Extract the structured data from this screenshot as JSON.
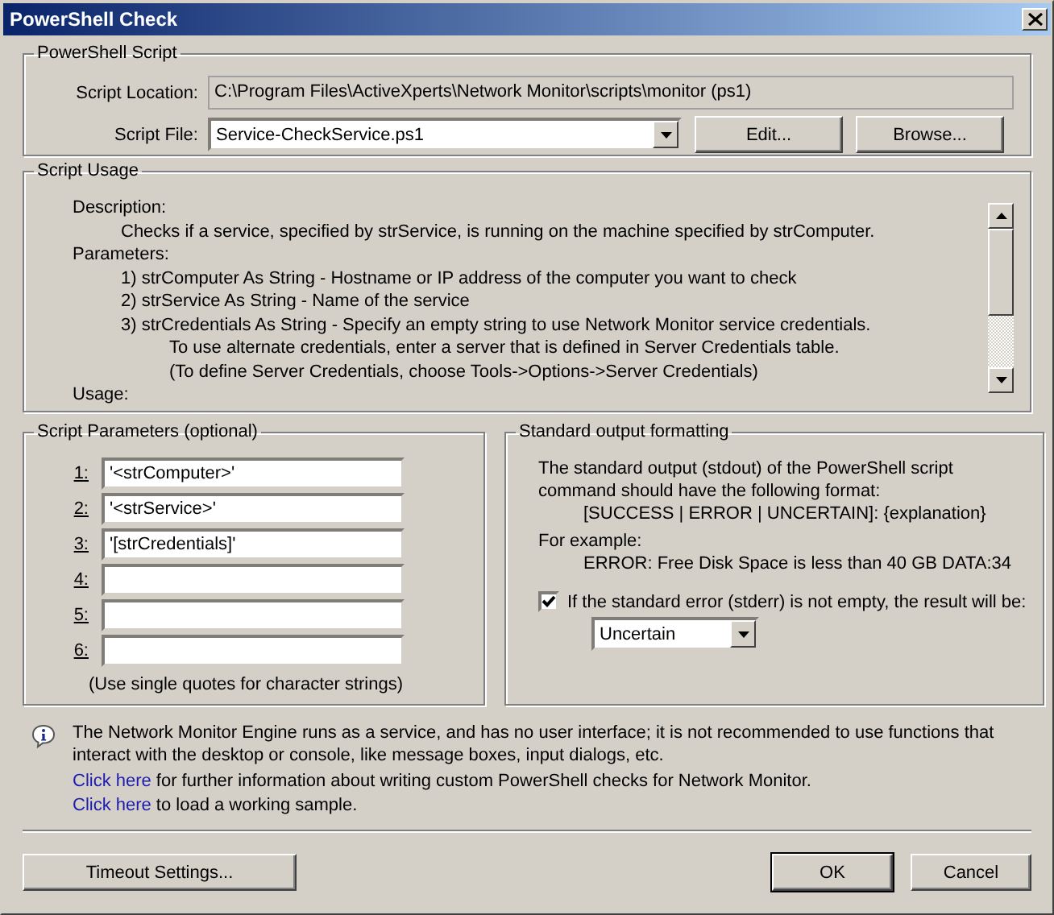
{
  "window": {
    "title": "PowerShell Check"
  },
  "script_group": {
    "title": "PowerShell Script",
    "location_label": "Script Location:",
    "location_value": "C:\\Program Files\\ActiveXperts\\Network Monitor\\scripts\\monitor (ps1)",
    "file_label": "Script File:",
    "file_value": "Service-CheckService.ps1",
    "buttons": [
      "Edit...",
      "Browse..."
    ]
  },
  "usage_group": {
    "title": "Script Usage",
    "lines": [
      {
        "kind": "heading",
        "text": "Description:"
      },
      {
        "kind": "text",
        "text": "Checks if a service, specified by strService, is running on the machine specified by strComputer."
      },
      {
        "kind": "heading",
        "text": "Parameters:"
      },
      {
        "kind": "text",
        "text": "1) strComputer As String - Hostname or IP address of the computer you want to check"
      },
      {
        "kind": "text",
        "text": "2) strService As String - Name of the service"
      },
      {
        "kind": "text",
        "text": "3) strCredentials As String - Specify an empty string to use Network Monitor service credentials."
      },
      {
        "kind": "continuation",
        "text": "To use alternate credentials, enter a server that is defined in Server Credentials table."
      },
      {
        "kind": "continuation",
        "text": "(To define Server Credentials, choose Tools->Options->Server Credentials)"
      },
      {
        "kind": "heading",
        "text": "Usage:"
      }
    ]
  },
  "params_group": {
    "title": "Script Parameters (optional)",
    "params": [
      {
        "label": "1:",
        "value": "'<strComputer>'"
      },
      {
        "label": "2:",
        "value": "'<strService>'"
      },
      {
        "label": "3:",
        "value": "'[strCredentials]'"
      },
      {
        "label": "4:"
      },
      {
        "label": "5:"
      },
      {
        "label": "6:"
      }
    ],
    "hint": "(Use single quotes for character strings)"
  },
  "output_group": {
    "title": "Standard output formatting",
    "intro": "The standard output (stdout) of the PowerShell script command should have the following format:",
    "format": "[SUCCESS | ERROR | UNCERTAIN]: {explanation}",
    "example_label": "For example:",
    "example": "ERROR: Free Disk Space is less than 40 GB DATA:34",
    "stderr_checkbox": {
      "label": "If the standard error (stderr) is not empty, the result will be:",
      "checked": true
    },
    "result_dropdown": "Uncertain"
  },
  "info": {
    "message": "The Network Monitor Engine runs as a service, and has no user interface; it is not recommended to use functions that interact with the desktop or console, like message boxes, input dialogs, etc.",
    "links": [
      {
        "link": "Click here",
        "text": "for further information about writing custom PowerShell checks for Network Monitor."
      },
      {
        "link": "Click here",
        "text": "to load a working sample."
      }
    ]
  },
  "footer": {
    "timeout_button": "Timeout Settings...",
    "ok_button": "OK",
    "cancel_button": "Cancel"
  }
}
